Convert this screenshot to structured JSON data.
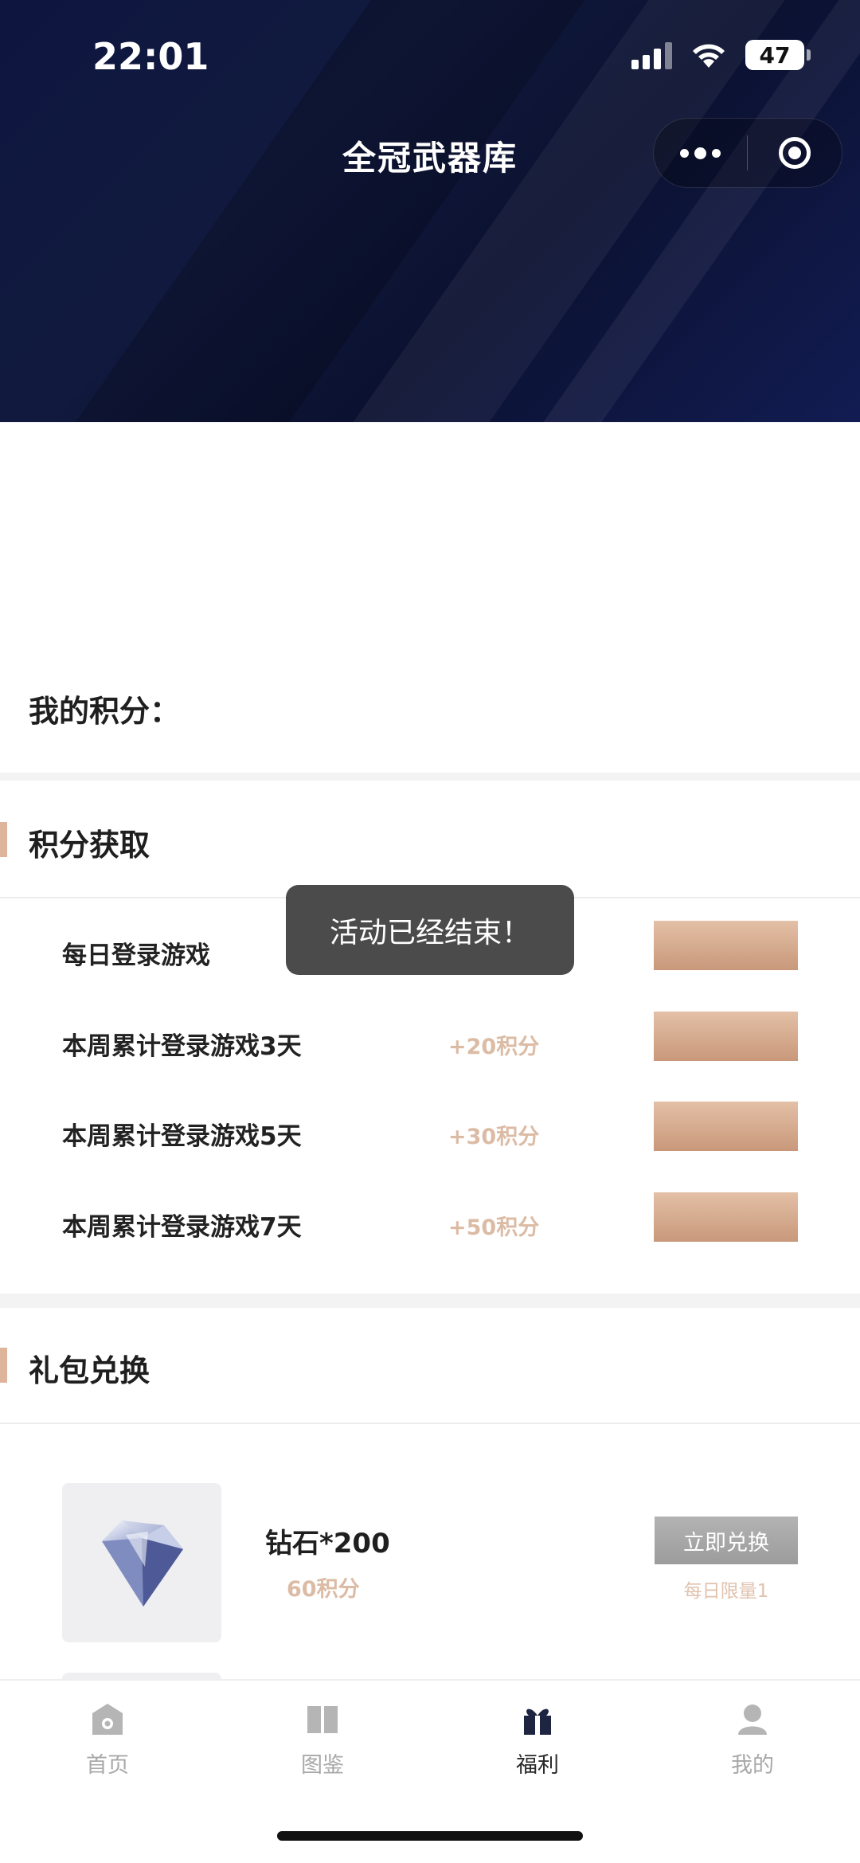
{
  "status_bar": {
    "time": "22:01",
    "battery": "47"
  },
  "header": {
    "title": "全冠武器库"
  },
  "points": {
    "label": "我的积分："
  },
  "earn_section": {
    "title": "积分获取",
    "tasks": [
      {
        "name": "每日登录游戏",
        "points": ""
      },
      {
        "name": "本周累计登录游戏3天",
        "points": "+20积分"
      },
      {
        "name": "本周累计登录游戏5天",
        "points": "+30积分"
      },
      {
        "name": "本周累计登录游戏7天",
        "points": "+50积分"
      }
    ]
  },
  "toast": {
    "message": "活动已经结束！"
  },
  "redeem_section": {
    "title": "礼包兑换",
    "items": [
      {
        "name": "钻石*200",
        "cost": "60积分",
        "button": "立即兑换",
        "limit": "每日限量1"
      }
    ]
  },
  "tabbar": {
    "tabs": [
      {
        "label": "首页",
        "icon": "home-icon",
        "active": false
      },
      {
        "label": "图鉴",
        "icon": "book-icon",
        "active": false
      },
      {
        "label": "福利",
        "icon": "gift-icon",
        "active": true
      },
      {
        "label": "我的",
        "icon": "user-icon",
        "active": false
      }
    ]
  },
  "colors": {
    "accent": "#deb59a",
    "banner": "#0e1640",
    "points_text": "#dcbba5"
  }
}
